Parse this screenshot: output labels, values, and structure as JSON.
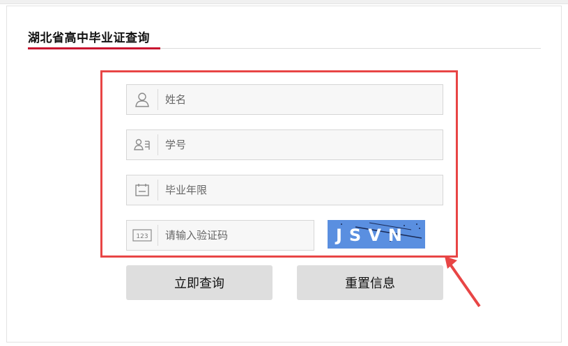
{
  "title": "湖北省高中毕业证查询",
  "form": {
    "name_placeholder": "姓名",
    "student_id_placeholder": "学号",
    "grad_year_placeholder": "毕业年限",
    "captcha_placeholder": "请输入验证码",
    "captcha_text": "JSVN"
  },
  "buttons": {
    "query_label": "立即查询",
    "reset_label": "重置信息"
  },
  "colors": {
    "accent_red": "#c8102e",
    "highlight_red": "#e84545",
    "captcha_bg": "#5a8fe0"
  },
  "icons": [
    "user-icon",
    "id-card-icon",
    "calendar-icon",
    "number-123-icon"
  ]
}
